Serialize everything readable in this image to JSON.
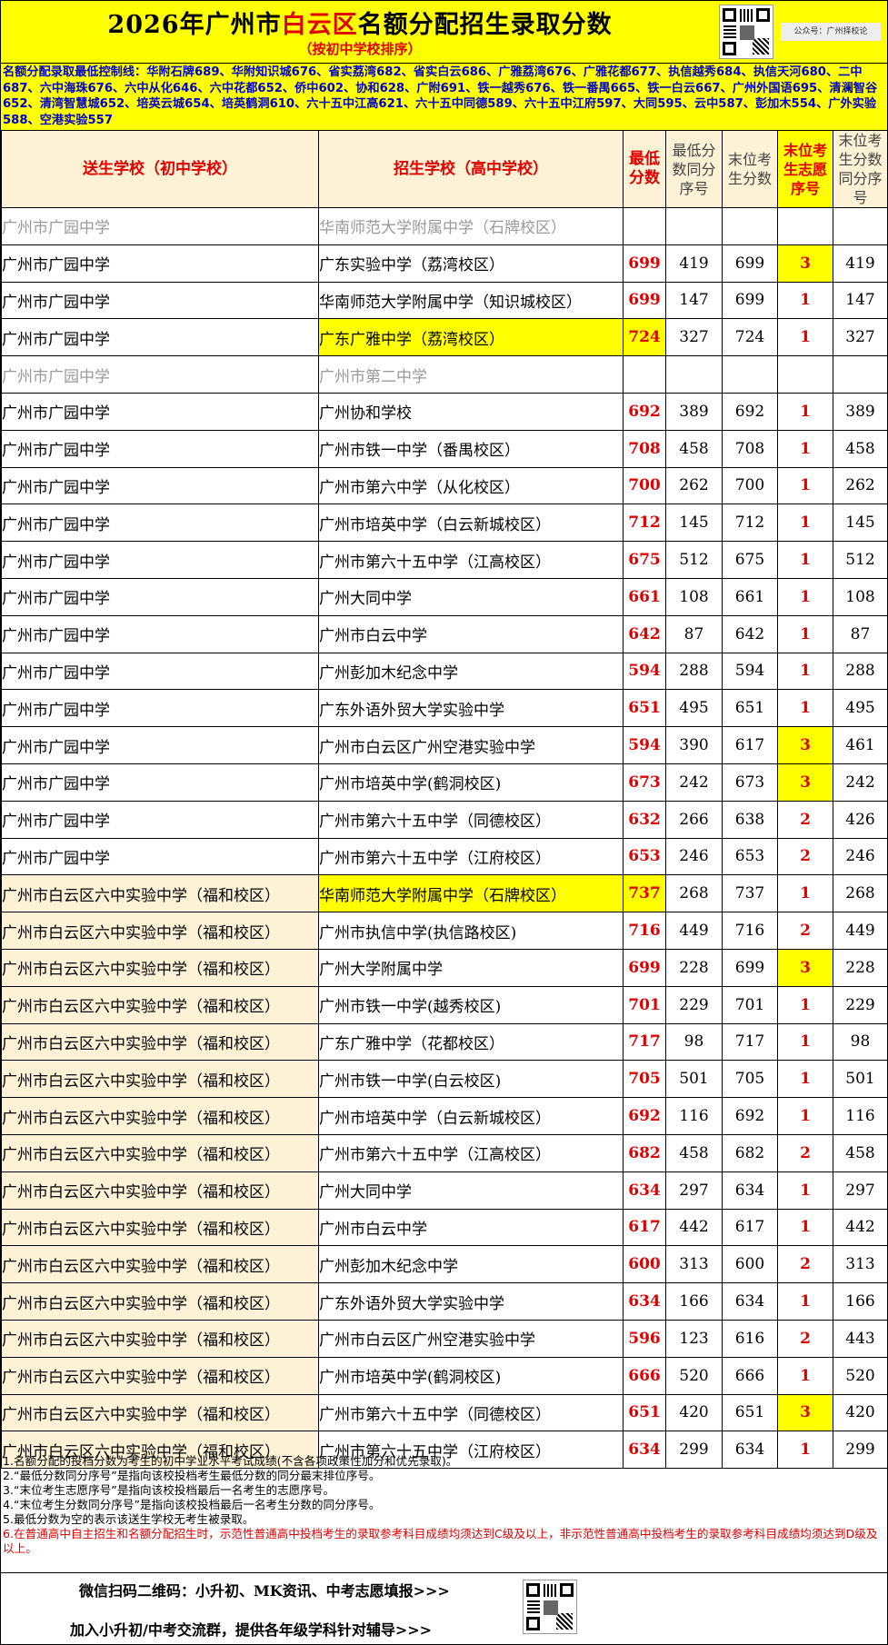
{
  "header": {
    "title_pre": "2026年广州市",
    "title_hl": "白云区",
    "title_post": "名额分配招生录取分数",
    "subtitle": "（按初中学校排序）",
    "qr_label": "公众号：广州择校论"
  },
  "notice": "名额分配录取最低控制线：华附石牌689、华附知识城676、省实荔湾682、省实白云686、广雅荔湾676、广雅花都677、执信越秀684、执信天河680、二中687、六中海珠676、六中从化646、六中花都652、侨中602、协和628、广附691、铁一越秀676、铁一番禺665、铁一白云667、广州外国语695、清澜智谷652、清湾智慧城652、培英云城654、培英鹤洞610、六十五中江高621、六十五中同德589、六十五中江府597、大同595、云中587、彭加木554、广外实验588、空港实验557",
  "table": {
    "headers": [
      "送生学校（初中学校）",
      "招生学校（高中学校）",
      "最低分数",
      "最低分数同分序号",
      "末位考生分数",
      "末位考生志愿序号",
      "末位考生分数同分序号"
    ],
    "rows": [
      {
        "from": "广州市广园中学",
        "to": "华南师范大学附属中学（石牌校区）",
        "min": "",
        "min_rank": "",
        "last": "",
        "vol": "",
        "last_rank": "",
        "grey": true
      },
      {
        "from": "广州市广园中学",
        "to": "广东实验中学（荔湾校区）",
        "min": "699",
        "min_rank": "419",
        "last": "699",
        "vol": "3",
        "last_rank": "419",
        "vol_hl": true
      },
      {
        "from": "广州市广园中学",
        "to": "华南师范大学附属中学（知识城校区）",
        "min": "699",
        "min_rank": "147",
        "last": "699",
        "vol": "1",
        "last_rank": "147"
      },
      {
        "from": "广州市广园中学",
        "to": "广东广雅中学（荔湾校区）",
        "min": "724",
        "min_rank": "327",
        "last": "724",
        "vol": "1",
        "last_rank": "327",
        "to_hl": true,
        "min_hl": true
      },
      {
        "from": "广州市广园中学",
        "to": "广州市第二中学",
        "min": "",
        "min_rank": "",
        "last": "",
        "vol": "",
        "last_rank": "",
        "grey": true
      },
      {
        "from": "广州市广园中学",
        "to": "广州协和学校",
        "min": "692",
        "min_rank": "389",
        "last": "692",
        "vol": "1",
        "last_rank": "389"
      },
      {
        "from": "广州市广园中学",
        "to": "广州市铁一中学（番禺校区）",
        "min": "708",
        "min_rank": "458",
        "last": "708",
        "vol": "1",
        "last_rank": "458"
      },
      {
        "from": "广州市广园中学",
        "to": "广州市第六中学（从化校区）",
        "min": "700",
        "min_rank": "262",
        "last": "700",
        "vol": "1",
        "last_rank": "262"
      },
      {
        "from": "广州市广园中学",
        "to": "广州市培英中学（白云新城校区）",
        "min": "712",
        "min_rank": "145",
        "last": "712",
        "vol": "1",
        "last_rank": "145"
      },
      {
        "from": "广州市广园中学",
        "to": "广州市第六十五中学（江高校区）",
        "min": "675",
        "min_rank": "512",
        "last": "675",
        "vol": "1",
        "last_rank": "512"
      },
      {
        "from": "广州市广园中学",
        "to": "广州大同中学",
        "min": "661",
        "min_rank": "108",
        "last": "661",
        "vol": "1",
        "last_rank": "108"
      },
      {
        "from": "广州市广园中学",
        "to": "广州市白云中学",
        "min": "642",
        "min_rank": "87",
        "last": "642",
        "vol": "1",
        "last_rank": "87"
      },
      {
        "from": "广州市广园中学",
        "to": "广州彭加木纪念中学",
        "min": "594",
        "min_rank": "288",
        "last": "594",
        "vol": "1",
        "last_rank": "288"
      },
      {
        "from": "广州市广园中学",
        "to": "广东外语外贸大学实验中学",
        "min": "651",
        "min_rank": "495",
        "last": "651",
        "vol": "1",
        "last_rank": "495"
      },
      {
        "from": "广州市广园中学",
        "to": "广州市白云区广州空港实验中学",
        "min": "594",
        "min_rank": "390",
        "last": "617",
        "vol": "3",
        "last_rank": "461",
        "vol_hl": true
      },
      {
        "from": "广州市广园中学",
        "to": "广州市培英中学(鹤洞校区)",
        "min": "673",
        "min_rank": "242",
        "last": "673",
        "vol": "3",
        "last_rank": "242",
        "vol_hl": true
      },
      {
        "from": "广州市广园中学",
        "to": "广州市第六十五中学（同德校区）",
        "min": "632",
        "min_rank": "266",
        "last": "638",
        "vol": "2",
        "last_rank": "426"
      },
      {
        "from": "广州市广园中学",
        "to": "广州市第六十五中学（江府校区）",
        "min": "653",
        "min_rank": "246",
        "last": "653",
        "vol": "2",
        "last_rank": "246"
      },
      {
        "from": "广州市白云区六中实验中学（福和校区）",
        "to": "华南师范大学附属中学（石牌校区）",
        "min": "737",
        "min_rank": "268",
        "last": "737",
        "vol": "1",
        "last_rank": "268",
        "to_hl": true,
        "min_hl": true,
        "beige": true
      },
      {
        "from": "广州市白云区六中实验中学（福和校区）",
        "to": "广州市执信中学(执信路校区)",
        "min": "716",
        "min_rank": "449",
        "last": "716",
        "vol": "2",
        "last_rank": "449",
        "beige": true
      },
      {
        "from": "广州市白云区六中实验中学（福和校区）",
        "to": "广州大学附属中学",
        "min": "699",
        "min_rank": "228",
        "last": "699",
        "vol": "3",
        "last_rank": "228",
        "vol_hl": true,
        "beige": true
      },
      {
        "from": "广州市白云区六中实验中学（福和校区）",
        "to": "广州市铁一中学(越秀校区)",
        "min": "701",
        "min_rank": "229",
        "last": "701",
        "vol": "1",
        "last_rank": "229",
        "beige": true
      },
      {
        "from": "广州市白云区六中实验中学（福和校区）",
        "to": "广东广雅中学（花都校区）",
        "min": "717",
        "min_rank": "98",
        "last": "717",
        "vol": "1",
        "last_rank": "98",
        "beige": true
      },
      {
        "from": "广州市白云区六中实验中学（福和校区）",
        "to": "广州市铁一中学(白云校区)",
        "min": "705",
        "min_rank": "501",
        "last": "705",
        "vol": "1",
        "last_rank": "501",
        "beige": true
      },
      {
        "from": "广州市白云区六中实验中学（福和校区）",
        "to": "广州市培英中学（白云新城校区）",
        "min": "692",
        "min_rank": "116",
        "last": "692",
        "vol": "1",
        "last_rank": "116",
        "beige": true
      },
      {
        "from": "广州市白云区六中实验中学（福和校区）",
        "to": "广州市第六十五中学（江高校区）",
        "min": "682",
        "min_rank": "458",
        "last": "682",
        "vol": "2",
        "last_rank": "458",
        "beige": true
      },
      {
        "from": "广州市白云区六中实验中学（福和校区）",
        "to": "广州大同中学",
        "min": "634",
        "min_rank": "297",
        "last": "634",
        "vol": "1",
        "last_rank": "297",
        "beige": true
      },
      {
        "from": "广州市白云区六中实验中学（福和校区）",
        "to": "广州市白云中学",
        "min": "617",
        "min_rank": "442",
        "last": "617",
        "vol": "1",
        "last_rank": "442",
        "beige": true
      },
      {
        "from": "广州市白云区六中实验中学（福和校区）",
        "to": "广州彭加木纪念中学",
        "min": "600",
        "min_rank": "313",
        "last": "600",
        "vol": "2",
        "last_rank": "313",
        "beige": true
      },
      {
        "from": "广州市白云区六中实验中学（福和校区）",
        "to": "广东外语外贸大学实验中学",
        "min": "634",
        "min_rank": "166",
        "last": "634",
        "vol": "1",
        "last_rank": "166",
        "beige": true
      },
      {
        "from": "广州市白云区六中实验中学（福和校区）",
        "to": "广州市白云区广州空港实验中学",
        "min": "596",
        "min_rank": "123",
        "last": "616",
        "vol": "2",
        "last_rank": "443",
        "beige": true
      },
      {
        "from": "广州市白云区六中实验中学（福和校区）",
        "to": "广州市培英中学(鹤洞校区)",
        "min": "666",
        "min_rank": "520",
        "last": "666",
        "vol": "1",
        "last_rank": "520",
        "beige": true
      },
      {
        "from": "广州市白云区六中实验中学（福和校区）",
        "to": "广州市第六十五中学（同德校区）",
        "min": "651",
        "min_rank": "420",
        "last": "651",
        "vol": "3",
        "last_rank": "420",
        "vol_hl": true,
        "beige": true
      },
      {
        "from": "广州市白云区六中实验中学（福和校区）",
        "to": "广州市第六十五中学（江府校区）",
        "min": "634",
        "min_rank": "299",
        "last": "634",
        "vol": "1",
        "last_rank": "299",
        "beige": true
      }
    ]
  },
  "notes": [
    "1.名额分配的投档分数为考生的初中学业水平考试成绩(不含各项政策性加分和优先录取)。",
    "2.“最低分数同分序号”是指向该校投档考生最低分数的同分最末排位序号。",
    "3.“末位考生志愿序号”是指向该校投档最后一名考生的志愿序号。",
    "4.“末位考生分数同分序号”是指向该校投档最后一名考生分数的同分序号。",
    "5.最低分数为空的表示该送生学校无考生被录取。"
  ],
  "note6": "6.在普通高中自主招生和名额分配招生时，示范性普通高中投档考生的录取参考科目成绩均须达到C级及以上，非示范性普通高中投档考生的录取参考科目成绩均须达到D级及以上。",
  "promo": {
    "line1": "微信扫码二维码：小升初、MK资讯、中考志愿填报>>>",
    "line2": "加入小升初/中考交流群，提供各年级学科针对辅导>>>"
  },
  "colors": {
    "highlight": "#ffff00",
    "accent_red": "#e00000",
    "notice_blue": "#0000cc",
    "beige": "#fdf1d6"
  },
  "icons": [
    "qr-code-icon"
  ]
}
